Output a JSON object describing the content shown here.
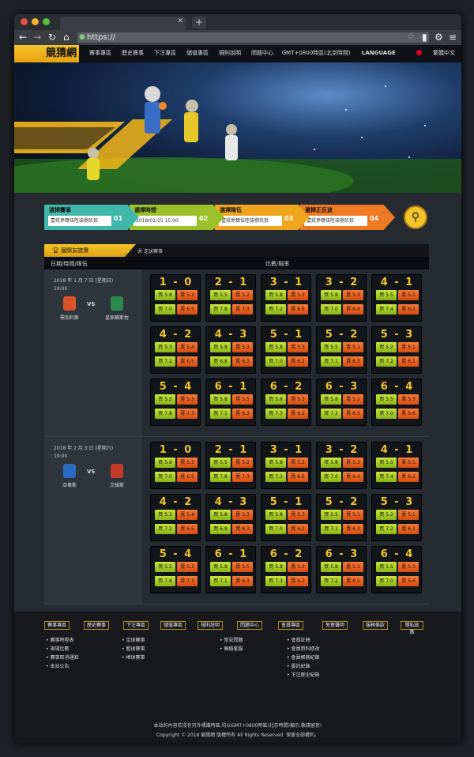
{
  "browser": {
    "url": "https://",
    "new_tab": "+"
  },
  "site": {
    "logo": "競猜網",
    "nav": [
      "賽事專區",
      "歷史賽事",
      "下注專區",
      "儲值專區",
      "規則說明",
      "問題中心"
    ],
    "timezone": "GMT+0800時區(北京時間)",
    "language_label": "LANGUAGE",
    "language_value": "繁體中文"
  },
  "steps": [
    {
      "label": "選擇賽事",
      "value": "壹貳參肆伍陸柒捌玖拾",
      "num": "01",
      "color": "#3fb8aa"
    },
    {
      "label": "選擇時間",
      "value": "2018/01/15 15:00",
      "num": "02",
      "color": "#9bc12a"
    },
    {
      "label": "選擇隊伍",
      "value": "壹貳參肆伍陸柒捌玖拾",
      "num": "03",
      "color": "#f0a51e"
    },
    {
      "label": "選擇正反波",
      "value": "壹貳參肆伍陸柒捌玖拾",
      "num": "04",
      "color": "#ee7a24"
    }
  ],
  "panel": {
    "tab_label": "國際友誼賽",
    "tab2_label": "足球賽事",
    "col1": "日期/時間/隊伍",
    "col2": "比數/賠率"
  },
  "odds_labels": {
    "buy": "買",
    "sell": "賣"
  },
  "matches": [
    {
      "date": "2018 年 1 月 7 日 (星期日)",
      "time": "19:00",
      "home": "需加利斯",
      "away": "皇家蘇斯佐",
      "home_color": "#d9532b",
      "away_color": "#2c8a4e",
      "cells": [
        {
          "score": "1 - 0",
          "b1": "5.8",
          "s1": "5.3",
          "b2": "7.0",
          "s2": "6.5"
        },
        {
          "score": "2 - 1",
          "b1": "5.5",
          "s1": "5.2",
          "b2": "7.8",
          "s2": "7.3"
        },
        {
          "score": "3 - 1",
          "b1": "5.8",
          "s1": "5.3",
          "b2": "7.2",
          "s2": "6.5"
        },
        {
          "score": "3 - 2",
          "b1": "5.8",
          "s1": "5.3",
          "b2": "7.0",
          "s2": "6.4"
        },
        {
          "score": "4 - 1",
          "b1": "5.5",
          "s1": "5.1",
          "b2": "7.4",
          "s2": "6.2"
        },
        {
          "score": "4 - 2",
          "b1": "5.3",
          "s1": "5.4",
          "b2": "7.2",
          "s2": "6.5"
        },
        {
          "score": "4 - 3",
          "b1": "5.8",
          "s1": "5.3",
          "b2": "6.8",
          "s2": "6.3"
        },
        {
          "score": "5 - 1",
          "b1": "5.8",
          "s1": "5.3",
          "b2": "7.0",
          "s2": "6.2"
        },
        {
          "score": "5 - 2",
          "b1": "5.5",
          "s1": "5.1",
          "b2": "7.1",
          "s2": "6.3"
        },
        {
          "score": "5 - 3",
          "b1": "5.2",
          "s1": "5.1",
          "b2": "7.2",
          "s2": "6.1"
        },
        {
          "score": "5 - 4",
          "b1": "5.5",
          "s1": "5.3",
          "b2": "7.8",
          "s2": "7.3"
        },
        {
          "score": "6 - 1",
          "b1": "5.8",
          "s1": "5.5",
          "b2": "7.1",
          "s2": "6.3"
        },
        {
          "score": "6 - 2",
          "b1": "5.8",
          "s1": "5.3",
          "b2": "7.3",
          "s2": "6.2"
        },
        {
          "score": "6 - 3",
          "b1": "5.8",
          "s1": "5.1",
          "b2": "7.2",
          "s2": "6.5"
        },
        {
          "score": "6 - 4",
          "b1": "5.5",
          "s1": "5.3",
          "b2": "7.0",
          "s2": "5.6"
        }
      ]
    },
    {
      "date": "2018 年 2 月 3 日 (星期六)",
      "time": "19:00",
      "home": "亞韋斯",
      "away": "艾維斯",
      "home_color": "#2a6cc4",
      "away_color": "#c43a2a",
      "cells": [
        {
          "score": "1 - 0",
          "b1": "5.8",
          "s1": "5.3",
          "b2": "7.0",
          "s2": "6.5"
        },
        {
          "score": "2 - 1",
          "b1": "5.5",
          "s1": "5.2",
          "b2": "7.8",
          "s2": "7.3"
        },
        {
          "score": "3 - 1",
          "b1": "5.8",
          "s1": "5.3",
          "b2": "7.2",
          "s2": "6.5"
        },
        {
          "score": "3 - 2",
          "b1": "5.8",
          "s1": "5.3",
          "b2": "7.0",
          "s2": "6.4"
        },
        {
          "score": "4 - 1",
          "b1": "5.5",
          "s1": "5.1",
          "b2": "7.4",
          "s2": "6.2"
        },
        {
          "score": "4 - 2",
          "b1": "5.3",
          "s1": "5.4",
          "b2": "7.2",
          "s2": "6.5"
        },
        {
          "score": "4 - 3",
          "b1": "5.8",
          "s1": "5.3",
          "b2": "6.8",
          "s2": "6.3"
        },
        {
          "score": "5 - 1",
          "b1": "5.8",
          "s1": "5.3",
          "b2": "7.0",
          "s2": "6.2"
        },
        {
          "score": "5 - 2",
          "b1": "5.5",
          "s1": "5.1",
          "b2": "7.1",
          "s2": "6.3"
        },
        {
          "score": "5 - 3",
          "b1": "5.2",
          "s1": "5.1",
          "b2": "7.2",
          "s2": "6.1"
        },
        {
          "score": "5 - 4",
          "b1": "5.5",
          "s1": "5.3",
          "b2": "7.8",
          "s2": "7.3"
        },
        {
          "score": "6 - 1",
          "b1": "5.8",
          "s1": "5.5",
          "b2": "7.1",
          "s2": "6.3"
        },
        {
          "score": "6 - 2",
          "b1": "5.8",
          "s1": "5.3",
          "b2": "7.3",
          "s2": "6.2"
        },
        {
          "score": "6 - 3",
          "b1": "5.8",
          "s1": "5.1",
          "b2": "7.2",
          "s2": "6.5"
        },
        {
          "score": "6 - 4",
          "b1": "5.5",
          "s1": "5.3",
          "b2": "7.0",
          "s2": "5.6"
        }
      ]
    }
  ],
  "footer": {
    "nav": [
      "賽事專區",
      "歷史賽事",
      "下注專區",
      "儲值專區",
      "規則說明",
      "問題中心",
      "會員專區",
      "免責聲明",
      "服務條款",
      "隱私政策"
    ],
    "cols": [
      [
        "賽事時程表",
        "現場比數",
        "賽事取消通知",
        "本站公告"
      ],
      [
        "足球賽事",
        "籃球賽事",
        "棒球賽事"
      ],
      [],
      [],
      [
        "常見問題",
        "聯絡客服"
      ],
      [
        "會員註冊",
        "會員資料修改",
        "會員帳務紀錄",
        "委託紀錄",
        "下注歷史紀錄"
      ]
    ],
    "note1": "本站的內容若沒有另外標識時區,均以GMT+0800時區(北京時間)顯示,敬請留意!",
    "note2": "Copyright © 2018  競猜網  版權所有  All Rights Reserved. 保留全部權利。"
  }
}
